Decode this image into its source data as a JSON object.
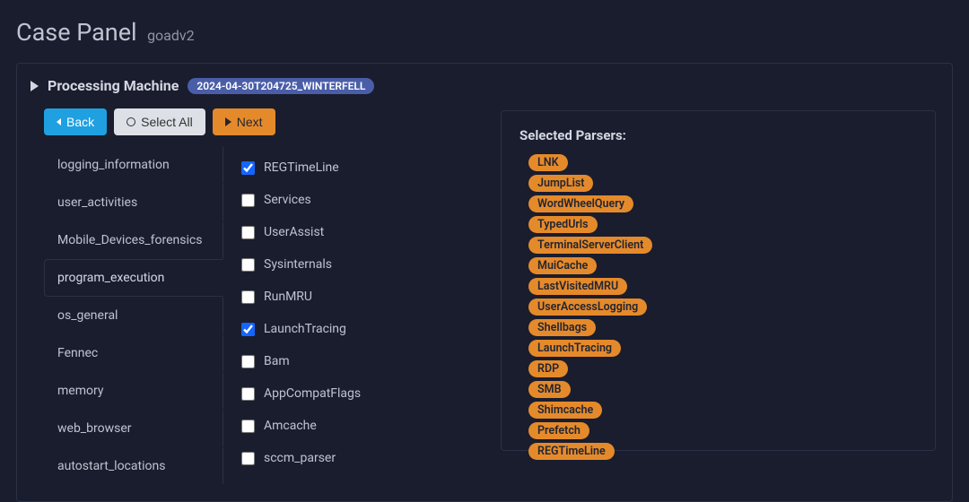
{
  "header": {
    "title": "Case Panel",
    "subtitle": "goadv2"
  },
  "processing": {
    "label": "Processing Machine",
    "badge": "2024-04-30T204725_WINTERFELL"
  },
  "buttons": {
    "back": "Back",
    "select_all": "Select All",
    "next": "Next"
  },
  "tabs": [
    {
      "label": "logging_information",
      "active": false
    },
    {
      "label": "user_activities",
      "active": false
    },
    {
      "label": "Mobile_Devices_forensics",
      "active": false
    },
    {
      "label": "program_execution",
      "active": true
    },
    {
      "label": "os_general",
      "active": false
    },
    {
      "label": "Fennec",
      "active": false
    },
    {
      "label": "memory",
      "active": false
    },
    {
      "label": "web_browser",
      "active": false
    },
    {
      "label": "autostart_locations",
      "active": false
    }
  ],
  "parsers": [
    {
      "label": "REGTimeLine",
      "checked": true
    },
    {
      "label": "Services",
      "checked": false
    },
    {
      "label": "UserAssist",
      "checked": false
    },
    {
      "label": "Sysinternals",
      "checked": false
    },
    {
      "label": "RunMRU",
      "checked": false
    },
    {
      "label": "LaunchTracing",
      "checked": true
    },
    {
      "label": "Bam",
      "checked": false
    },
    {
      "label": "AppCompatFlags",
      "checked": false
    },
    {
      "label": "Amcache",
      "checked": false
    },
    {
      "label": "sccm_parser",
      "checked": false
    }
  ],
  "selected": {
    "title": "Selected Parsers:",
    "items": [
      "LNK",
      "JumpList",
      "WordWheelQuery",
      "TypedUrls",
      "TerminalServerClient",
      "MuiCache",
      "LastVisitedMRU",
      "UserAccessLogging",
      "Shellbags",
      "LaunchTracing",
      "RDP",
      "SMB",
      "Shimcache",
      "Prefetch",
      "REGTimeLine"
    ]
  }
}
